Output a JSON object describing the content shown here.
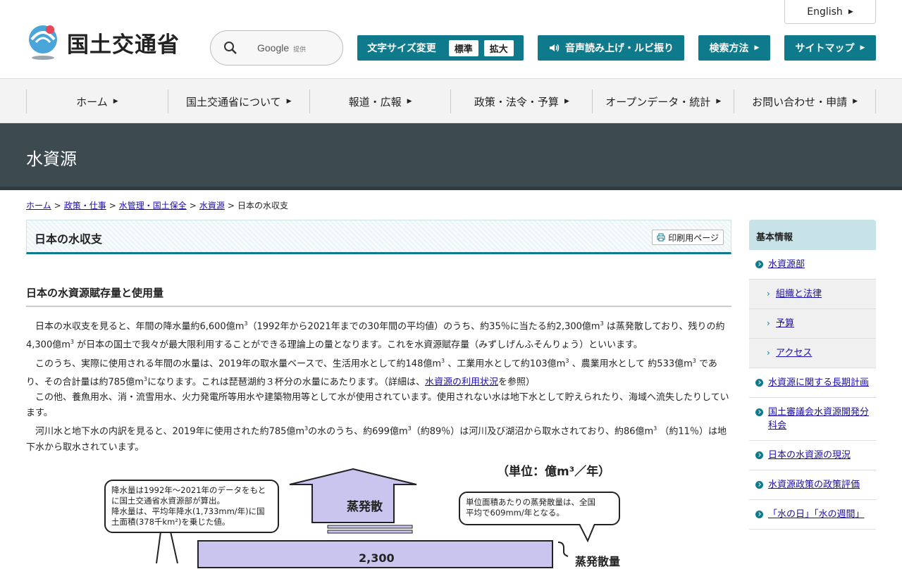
{
  "header": {
    "logo_text": "国土交通省",
    "search": {
      "provider": "Google",
      "provider_suffix": "提供"
    },
    "lang_label": "English",
    "font_size": {
      "label": "文字サイズ変更",
      "standard": "標準",
      "large": "拡大"
    },
    "tools": [
      {
        "label": "音声読み上げ・ルビ振り"
      },
      {
        "label": "検索方法"
      },
      {
        "label": "サイトマップ"
      }
    ]
  },
  "nav": {
    "items": [
      {
        "label": "ホーム"
      },
      {
        "label": "国土交通省について"
      },
      {
        "label": "報道・広報"
      },
      {
        "label": "政策・法令・予算"
      },
      {
        "label": "オープンデータ・統計"
      },
      {
        "label": "お問い合わせ・申請"
      }
    ]
  },
  "banner": {
    "title": "水資源"
  },
  "breadcrumb": {
    "links": [
      "ホーム",
      "政策・仕事",
      "水管理・国土保全",
      "水資源"
    ],
    "current": "日本の水収支"
  },
  "main": {
    "page_title": "日本の水収支",
    "print_label": "印刷用ページ",
    "section_heading": "日本の水資源賦存量と使用量",
    "p1": {
      "a": "日本の水収支を見ると、年間の降水量約6,600億m",
      "b": "（1992年から2021年までの30年間の平均値）のうち、約35％に当たる約2,300億m",
      "c": " は蒸発散しており、残りの約4,300億m",
      "d": " が日本の国土で我々が最大限利用することができる理論上の量となります。これを水資源賦存量（みずしげんふそんりょう）といいます。"
    },
    "p2": {
      "a": "このうち、実際に使用される年間の水量は、2019年の取水量ベースで、生活用水として約148億m",
      "b": " 、工業用水として約103億m",
      "c": " 、農業用水として 約533億m",
      "d": " であり、その合計量は約785億m",
      "e": "になります。これは琵琶湖約３杯分の水量にあたります。（詳細は、",
      "link": "水資源の利用状況",
      "f": "を参照）"
    },
    "p3": "この他、養魚用水、消・流雪用水、火力発電所等用水や建築物用等として水が使用されています。使用されない水は地下水として貯えられたり、海域へ流失したりしています。",
    "p4": {
      "a": "河川水と地下水の内訳を見ると、2019年に使用された約785億m",
      "b": "の水のうち、約699億m",
      "c": "（約89％）は河川及び湖沼から取水されており、約86億m",
      "d": " （約11％）は地下水から取水されています。"
    },
    "sup3": "3"
  },
  "figure": {
    "unit": "（単位：億m³／年）",
    "callout_left": [
      "降水量は1992年～2021年のデータをもと",
      "に国土交通省水資源部が算出。",
      "降水量は、平均年降水(1,733mm/年)に国",
      "土面積(378千km²)を乗じた値。"
    ],
    "callout_right": [
      "単位面積あたりの蒸発散量は、全国",
      "平均で609mm/年となる。"
    ],
    "evap_label": "蒸発散",
    "bar_value": "2,300",
    "brace_label": "蒸発散量",
    "colors": {
      "arrow_fill": "#c9c5ef"
    }
  },
  "sidebar": {
    "heading": "基本情報",
    "items": [
      {
        "label": "水資源部",
        "sub": false
      },
      {
        "label": "組織と法律",
        "sub": true
      },
      {
        "label": "予算",
        "sub": true
      },
      {
        "label": "アクセス",
        "sub": true
      },
      {
        "label": "水資源に関する長期計画",
        "sub": false
      },
      {
        "label": "国土審議会水資源開発分科会",
        "sub": false
      },
      {
        "label": "日本の水資源の現況",
        "sub": false
      },
      {
        "label": "水資源政策の政策評価",
        "sub": false
      },
      {
        "label": "「水の日」「水の週間」",
        "sub": false
      }
    ]
  }
}
